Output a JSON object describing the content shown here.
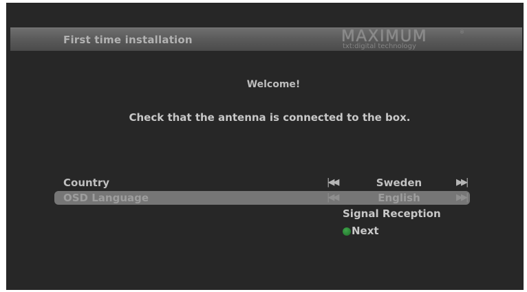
{
  "header": {
    "title": "First time installation",
    "brand_name": "MAXIMUM",
    "brand_mark": "®",
    "brand_tagline": "txt:digital technology"
  },
  "welcome": "Welcome!",
  "instruction": "Check that the antenna is connected to the box.",
  "settings": [
    {
      "label": "Country",
      "value": "Sweden",
      "prev_icon": "skip-back-icon",
      "next_icon": "skip-forward-icon",
      "selected": false
    },
    {
      "label": "OSD Language",
      "value": "English",
      "prev_icon": "skip-back-icon",
      "next_icon": "skip-forward-icon",
      "selected": true
    }
  ],
  "nav_glyphs": {
    "prev": "|◀◀",
    "next": "▶▶|"
  },
  "actions": {
    "signal_reception": "Signal Reception",
    "next_label": "Next",
    "next_key_color": "#2e8b3a"
  },
  "colors": {
    "background": "#272727",
    "selected_row": "#767676",
    "text": "#c8c8c8"
  }
}
